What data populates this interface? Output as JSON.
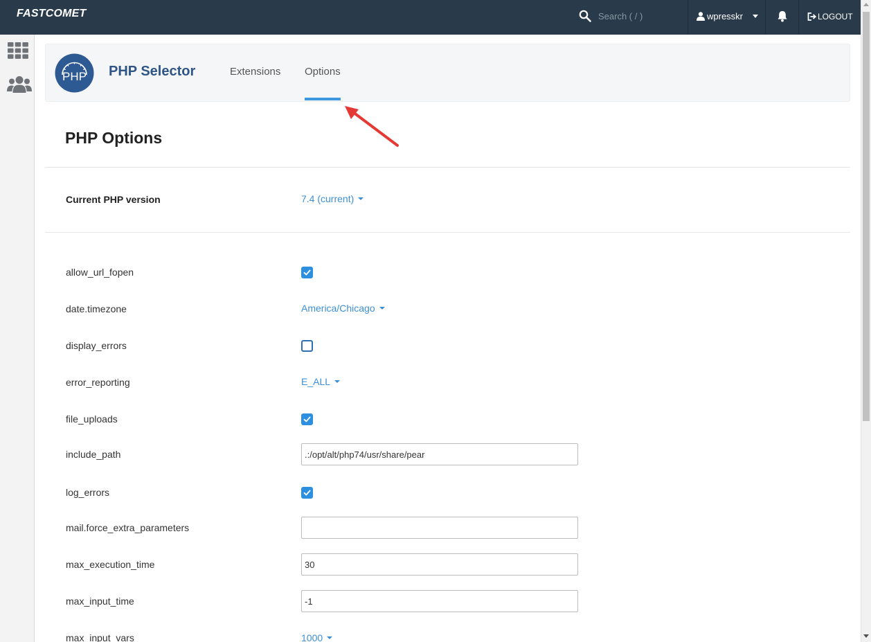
{
  "topbar": {
    "logo": "FASTCOMET",
    "search_placeholder": "Search ( / )",
    "username": "wpresskr",
    "logout_label": "LOGOUT"
  },
  "header": {
    "app_title": "PHP Selector",
    "logo_text": "PHP",
    "tabs": [
      {
        "label": "Extensions",
        "active": false
      },
      {
        "label": "Options",
        "active": true
      }
    ]
  },
  "main": {
    "title": "PHP Options",
    "version_label": "Current PHP version",
    "version_value": "7.4 (current)",
    "options": [
      {
        "name": "allow_url_fopen",
        "type": "checkbox",
        "checked": true
      },
      {
        "name": "date.timezone",
        "type": "select",
        "value": "America/Chicago"
      },
      {
        "name": "display_errors",
        "type": "checkbox",
        "checked": false
      },
      {
        "name": "error_reporting",
        "type": "select",
        "value": "E_ALL"
      },
      {
        "name": "file_uploads",
        "type": "checkbox",
        "checked": true
      },
      {
        "name": "include_path",
        "type": "text",
        "value": ".:/opt/alt/php74/usr/share/pear"
      },
      {
        "name": "log_errors",
        "type": "checkbox",
        "checked": true
      },
      {
        "name": "mail.force_extra_parameters",
        "type": "text",
        "value": ""
      },
      {
        "name": "max_execution_time",
        "type": "text",
        "value": "30"
      },
      {
        "name": "max_input_time",
        "type": "text",
        "value": "-1"
      },
      {
        "name": "max_input_vars",
        "type": "select",
        "value": "1000"
      }
    ]
  },
  "colors": {
    "topbar": "#293a4a",
    "accent": "#3b98e1",
    "link": "#3d8fd4",
    "title": "#2e5586",
    "annotation_arrow": "#e53935"
  }
}
